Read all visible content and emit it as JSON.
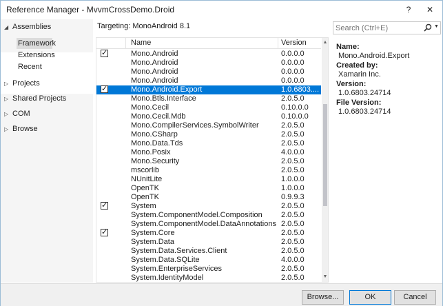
{
  "window": {
    "title": "Reference Manager - MvvmCrossDemo.Droid",
    "help": "?",
    "close": "✕"
  },
  "left_nav": {
    "assemblies": "Assemblies",
    "sub_items": [
      "Framework",
      "Extensions",
      "Recent"
    ],
    "projects": "Projects",
    "shared_projects": "Shared Projects",
    "com": "COM",
    "browse": "Browse"
  },
  "targeting": "Targeting: MonoAndroid 8.1",
  "grid": {
    "col_name": "Name",
    "col_version": "Version",
    "rows": [
      {
        "name": "Mono.Android",
        "version": "0.0.0.0",
        "checked": true,
        "selected": false
      },
      {
        "name": "Mono.Android",
        "version": "0.0.0.0",
        "checked": false,
        "selected": false
      },
      {
        "name": "Mono.Android",
        "version": "0.0.0.0",
        "checked": false,
        "selected": false
      },
      {
        "name": "Mono.Android",
        "version": "0.0.0.0",
        "checked": false,
        "selected": false
      },
      {
        "name": "Mono.Android.Export",
        "version": "1.0.6803....",
        "checked": true,
        "selected": true
      },
      {
        "name": "Mono.Btls.Interface",
        "version": "2.0.5.0",
        "checked": false,
        "selected": false
      },
      {
        "name": "Mono.Cecil",
        "version": "0.10.0.0",
        "checked": false,
        "selected": false
      },
      {
        "name": "Mono.Cecil.Mdb",
        "version": "0.10.0.0",
        "checked": false,
        "selected": false
      },
      {
        "name": "Mono.CompilerServices.SymbolWriter",
        "version": "2.0.5.0",
        "checked": false,
        "selected": false
      },
      {
        "name": "Mono.CSharp",
        "version": "2.0.5.0",
        "checked": false,
        "selected": false
      },
      {
        "name": "Mono.Data.Tds",
        "version": "2.0.5.0",
        "checked": false,
        "selected": false
      },
      {
        "name": "Mono.Posix",
        "version": "4.0.0.0",
        "checked": false,
        "selected": false
      },
      {
        "name": "Mono.Security",
        "version": "2.0.5.0",
        "checked": false,
        "selected": false
      },
      {
        "name": "mscorlib",
        "version": "2.0.5.0",
        "checked": false,
        "selected": false
      },
      {
        "name": "NUnitLite",
        "version": "1.0.0.0",
        "checked": false,
        "selected": false
      },
      {
        "name": "OpenTK",
        "version": "1.0.0.0",
        "checked": false,
        "selected": false
      },
      {
        "name": "OpenTK",
        "version": "0.9.9.3",
        "checked": false,
        "selected": false
      },
      {
        "name": "System",
        "version": "2.0.5.0",
        "checked": true,
        "selected": false
      },
      {
        "name": "System.ComponentModel.Composition",
        "version": "2.0.5.0",
        "checked": false,
        "selected": false
      },
      {
        "name": "System.ComponentModel.DataAnnotations",
        "version": "2.0.5.0",
        "checked": false,
        "selected": false
      },
      {
        "name": "System.Core",
        "version": "2.0.5.0",
        "checked": true,
        "selected": false
      },
      {
        "name": "System.Data",
        "version": "2.0.5.0",
        "checked": false,
        "selected": false
      },
      {
        "name": "System.Data.Services.Client",
        "version": "2.0.5.0",
        "checked": false,
        "selected": false
      },
      {
        "name": "System.Data.SQLite",
        "version": "4.0.0.0",
        "checked": false,
        "selected": false
      },
      {
        "name": "System.EnterpriseServices",
        "version": "2.0.5.0",
        "checked": false,
        "selected": false
      },
      {
        "name": "System.IdentityModel",
        "version": "2.0.5.0",
        "checked": false,
        "selected": false
      }
    ]
  },
  "search": {
    "placeholder": "Search (Ctrl+E)"
  },
  "details": {
    "name_label": "Name:",
    "name_value": "Mono.Android.Export",
    "created_label": "Created by:",
    "created_value": "Xamarin Inc.",
    "version_label": "Version:",
    "version_value": "1.0.6803.24714",
    "file_version_label": "File Version:",
    "file_version_value": "1.0.6803.24714"
  },
  "buttons": {
    "browse": "Browse...",
    "ok": "OK",
    "cancel": "Cancel"
  },
  "icons": {
    "search": "magnifier-icon",
    "expanded": "triangle-down-icon",
    "collapsed": "triangle-right-icon"
  },
  "colors": {
    "selection": "#0078d7",
    "nav_background": "#f5f5f5"
  }
}
